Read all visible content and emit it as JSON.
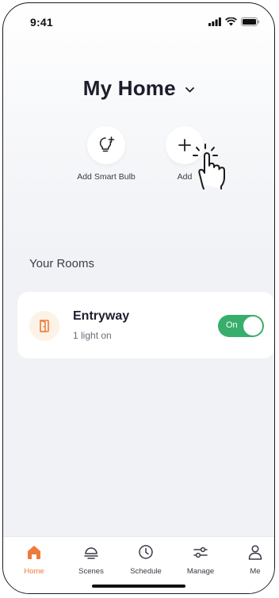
{
  "status_bar": {
    "time": "9:41"
  },
  "header": {
    "title": "My Home"
  },
  "actions": [
    {
      "label": "Add Smart Bulb",
      "icon": "bulb-plus-icon"
    },
    {
      "label": "Add",
      "icon": "plus-icon"
    }
  ],
  "rooms": {
    "section_title": "Your Rooms",
    "items": [
      {
        "name": "Entryway",
        "status": "1 light on",
        "toggle_label": "On",
        "toggle_on": true
      }
    ]
  },
  "tabs": [
    {
      "label": "Home",
      "icon": "home-icon",
      "active": true
    },
    {
      "label": "Scenes",
      "icon": "scenes-icon"
    },
    {
      "label": "Schedule",
      "icon": "clock-icon"
    },
    {
      "label": "Manage",
      "icon": "sliders-icon"
    },
    {
      "label": "Me",
      "icon": "user-icon"
    }
  ],
  "colors": {
    "accent": "#ef7a3a",
    "toggle_on": "#37ae6b",
    "room_icon_bg": "#fdf2e6"
  }
}
